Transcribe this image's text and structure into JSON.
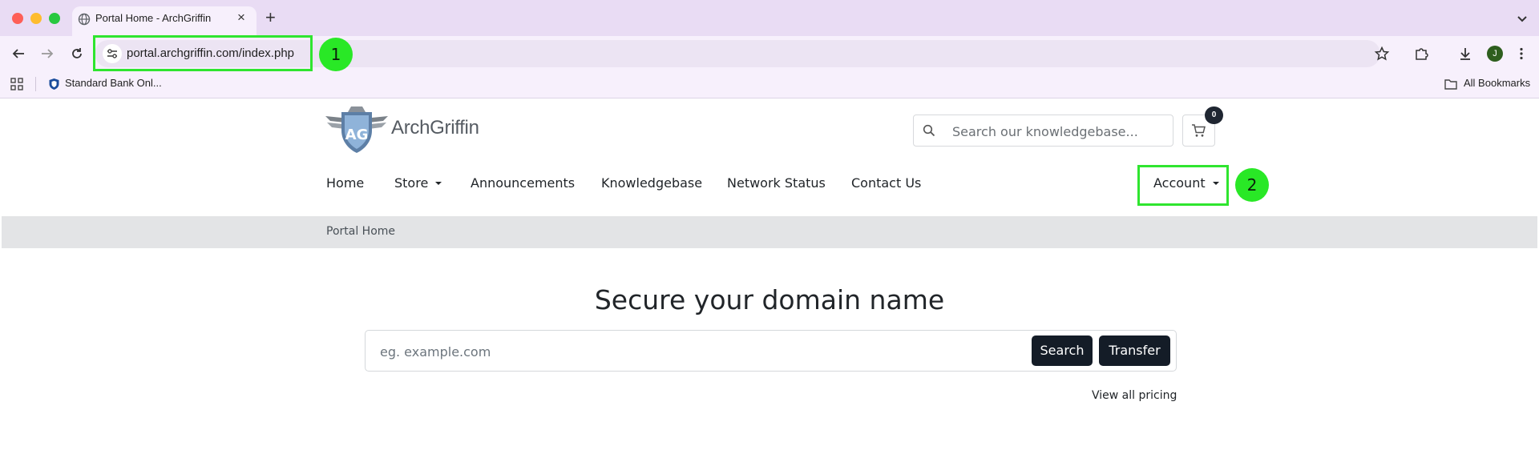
{
  "browser": {
    "tab_title": "Portal Home - ArchGriffin",
    "url": "portal.archgriffin.com/index.php",
    "avatar_initial": "J",
    "bookmarks": {
      "items": [
        "Standard Bank Onl..."
      ],
      "all_bookmarks_label": "All Bookmarks"
    }
  },
  "site": {
    "logo_text": "ArchGriffin",
    "logo_emblem": "AG",
    "search_placeholder": "Search our knowledgebase...",
    "cart_count": "0",
    "nav": {
      "home": "Home",
      "store": "Store",
      "announcements": "Announcements",
      "knowledgebase": "Knowledgebase",
      "network_status": "Network Status",
      "contact_us": "Contact Us",
      "account": "Account"
    },
    "breadcrumb": "Portal Home"
  },
  "hero": {
    "title": "Secure your domain name",
    "input_placeholder": "eg. example.com",
    "search_button": "Search",
    "transfer_button": "Transfer",
    "view_pricing": "View all pricing"
  },
  "annotations": {
    "badge_1": "1",
    "badge_2": "2",
    "highlight_color": "#2fe52f"
  },
  "colors": {
    "tab_bar": "#e9dcf4",
    "toolbar": "#f7f0fc",
    "button_dark": "#141c27",
    "breadcrumb_bar": "#e3e4e6"
  }
}
